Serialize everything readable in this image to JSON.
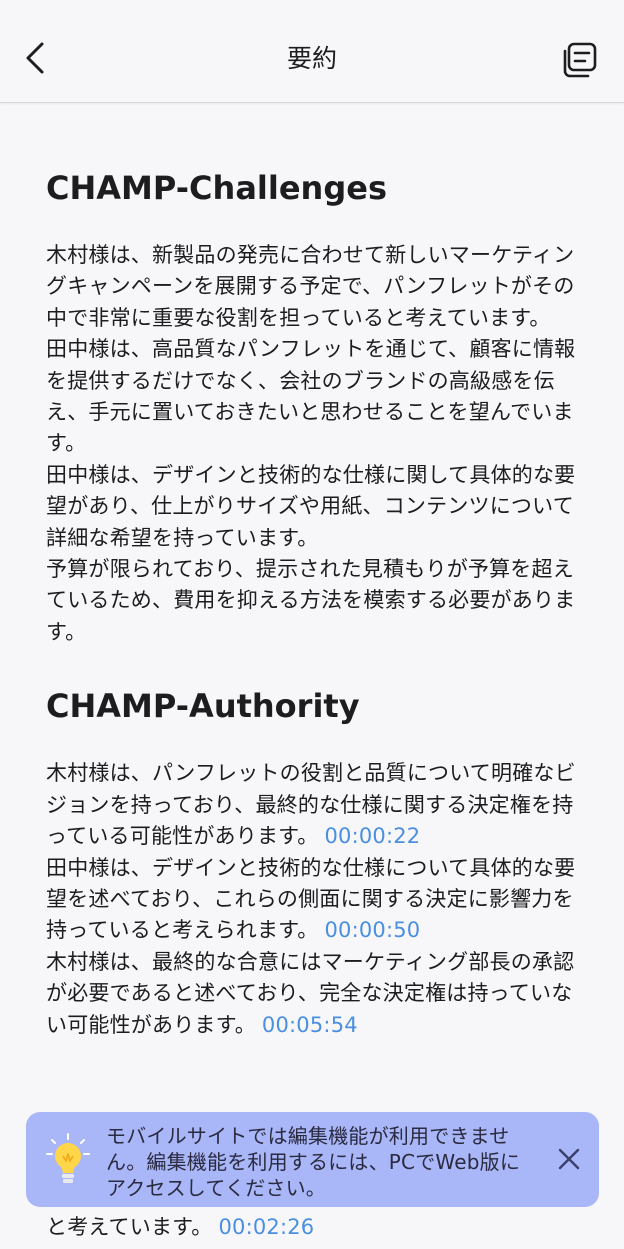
{
  "header": {
    "title": "要約"
  },
  "sections": [
    {
      "heading": "CHAMP-Challenges",
      "paragraphs": [
        {
          "text": "木村様は、新製品の発売に合わせて新しいマーケティングキャンペーンを展開する予定で、パンフレットがその中で非常に重要な役割を担っていると考えています。"
        },
        {
          "text": "田中様は、高品質なパンフレットを通じて、顧客に情報を提供するだけでなく、会社のブランドの高級感を伝え、手元に置いておきたいと思わせることを望んでいます。"
        },
        {
          "text": "田中様は、デザインと技術的な仕様に関して具体的な要望があり、仕上がりサイズや用紙、コンテンツについて詳細な希望を持っています。"
        },
        {
          "text": "予算が限られており、提示された見積もりが予算を超えているため、費用を抑える方法を模索する必要があります。"
        }
      ]
    },
    {
      "heading": "CHAMP-Authority",
      "paragraphs": [
        {
          "text": "木村様は、パンフレットの役割と品質について明確なビジョンを持っており、最終的な仕様に関する決定権を持っている可能性があります。",
          "timestamp": "00:00:22"
        },
        {
          "text": "田中様は、デザインと技術的な仕様について具体的な要望を述べており、これらの側面に関する決定に影響力を持っていると考えられます。",
          "timestamp": "00:00:50"
        },
        {
          "text": "木村様は、最終的な合意にはマーケティング部長の承認が必要であると述べており、完全な決定権は持っていない可能性があります。",
          "timestamp": "00:05:54"
        }
      ]
    }
  ],
  "bottom": {
    "text": "と考えています。",
    "timestamp": "00:02:26"
  },
  "banner": {
    "lines": [
      "モバイルサイトでは編集機能が利用できませ",
      "ん。編集機能を利用するには、PCでWeb版に",
      "アクセスしてください。"
    ]
  },
  "colors": {
    "timestamp": "#4a8fe0",
    "banner_bg": "#a9b6f7",
    "bulb": "#ffd54a"
  },
  "icons": {
    "back": "chevron-left-icon",
    "notes": "notes-icon",
    "bulb": "lightbulb-icon",
    "close": "close-icon"
  }
}
